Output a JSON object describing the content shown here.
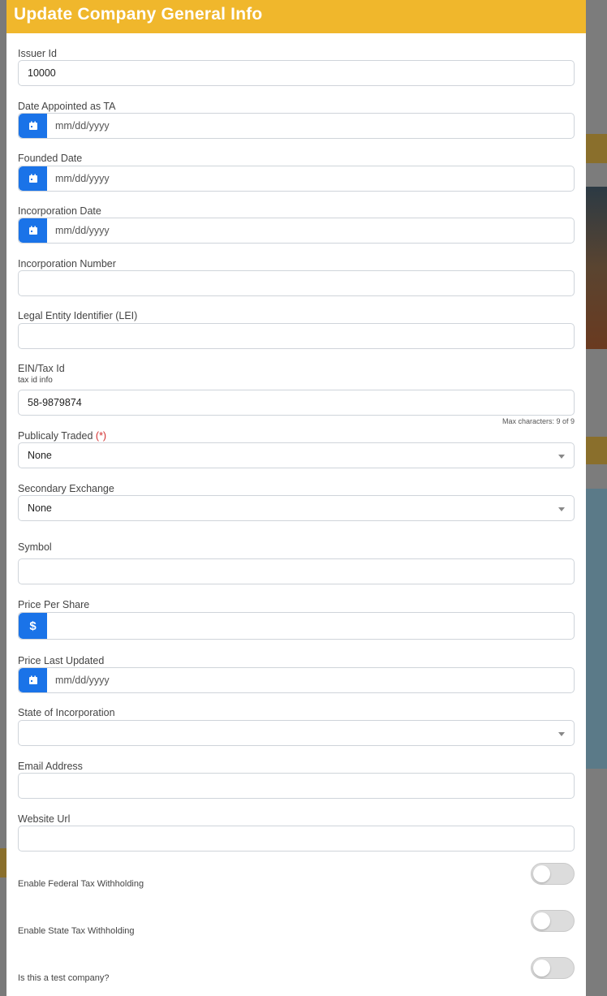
{
  "modal": {
    "title": "Update Company General Info"
  },
  "fields": {
    "issuer_id": {
      "label": "Issuer Id",
      "value": "10000"
    },
    "date_appointed": {
      "label": "Date Appointed as TA",
      "placeholder": "mm/dd/yyyy"
    },
    "founded_date": {
      "label": "Founded Date",
      "placeholder": "mm/dd/yyyy"
    },
    "incorporation_date": {
      "label": "Incorporation Date",
      "placeholder": "mm/dd/yyyy"
    },
    "incorporation_number": {
      "label": "Incorporation Number",
      "value": ""
    },
    "lei": {
      "label": "Legal Entity Identifier (LEI)",
      "value": ""
    },
    "ein": {
      "label": "EIN/Tax Id",
      "hint": "tax id info",
      "value": "58-9879874",
      "counter": "Max characters: 9 of 9"
    },
    "publicly_traded": {
      "label": "Publicaly Traded",
      "required_mark": "(*)",
      "value": "None"
    },
    "secondary_exchange": {
      "label": "Secondary Exchange",
      "value": "None"
    },
    "symbol": {
      "label": "Symbol",
      "value": ""
    },
    "price_per_share": {
      "label": "Price Per Share",
      "addon": "$",
      "value": ""
    },
    "price_last_updated": {
      "label": "Price Last Updated",
      "placeholder": "mm/dd/yyyy"
    },
    "state_of_incorporation": {
      "label": "State of Incorporation",
      "value": ""
    },
    "email": {
      "label": "Email Address",
      "value": ""
    },
    "website": {
      "label": "Website Url",
      "value": ""
    }
  },
  "toggles": {
    "federal_tax": {
      "label": "Enable Federal Tax Withholding",
      "on": false
    },
    "state_tax": {
      "label": "Enable State Tax Withholding",
      "on": false
    },
    "test_company": {
      "label": "Is this a test company?",
      "on": false
    }
  },
  "colors": {
    "header": "#f0b72c",
    "addon": "#1a73e8",
    "required": "#d32f2f"
  },
  "icons": {
    "calendar": "calendar-icon",
    "dropdown": "chevron-down-icon"
  }
}
